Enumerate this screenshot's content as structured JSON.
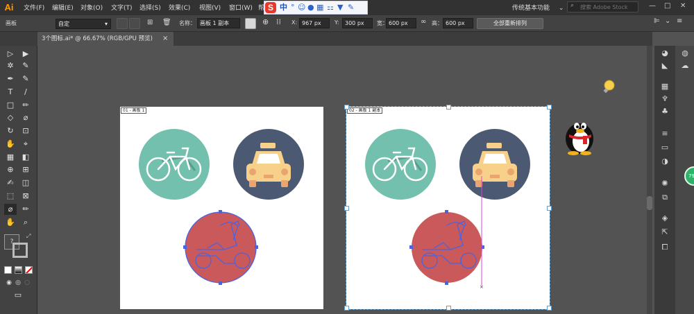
{
  "app": {
    "logo": "Ai"
  },
  "menu": [
    "文件(F)",
    "编辑(E)",
    "对象(O)",
    "文字(T)",
    "选择(S)",
    "效果(C)",
    "视图(V)",
    "窗口(W)",
    "帮"
  ],
  "ime": {
    "logo": "S",
    "mode": "中"
  },
  "workspace": {
    "label": "传统基本功能",
    "caret": "⌄"
  },
  "search": {
    "placeholder": "搜索 Adobe Stock"
  },
  "window_controls": {
    "minimize": "—",
    "maximize": "□",
    "close": "✕"
  },
  "control_bar": {
    "panel_label": "画板",
    "preset": "自定",
    "name_label": "名称：",
    "name_value": "画板 1 副本",
    "x_label": "X:",
    "x_value": "967 px",
    "y_label": "Y:",
    "y_value": "300 px",
    "w_label": "宽：",
    "w_value": "600 px",
    "h_label": "高：",
    "h_value": "600 px",
    "rearrange_all": "全部重新排列"
  },
  "document_tab": {
    "title": "3个图标.ai* @ 66.67% (RGB/GPU 预览)",
    "close": "×"
  },
  "artboards": [
    {
      "label": "01 - 画板 1"
    },
    {
      "label": "02 - 画板 1 副本"
    }
  ],
  "tools": [
    "▷",
    "▶",
    "✲",
    "✎",
    "✒",
    "T",
    "/",
    "□",
    "✏",
    "◇",
    "⌀",
    "↻",
    "⊡",
    "✋",
    "⌖",
    "▦",
    "◧",
    "⊕",
    "⊞",
    "◫",
    "⬚",
    "⊠",
    "✍",
    "✋",
    "⌕"
  ],
  "tool_help": "?",
  "colors": {
    "ui_dark": "#323232",
    "panel": "#424242",
    "canvas": "#535353",
    "artboard": "#ffffff",
    "teal": "#72c0ad",
    "navy": "#4b5a72",
    "red": "#c9595a",
    "taxi": "#f7d08a",
    "selection": "#4a64e0",
    "guide": "#d844d8"
  },
  "side_badge": "79"
}
